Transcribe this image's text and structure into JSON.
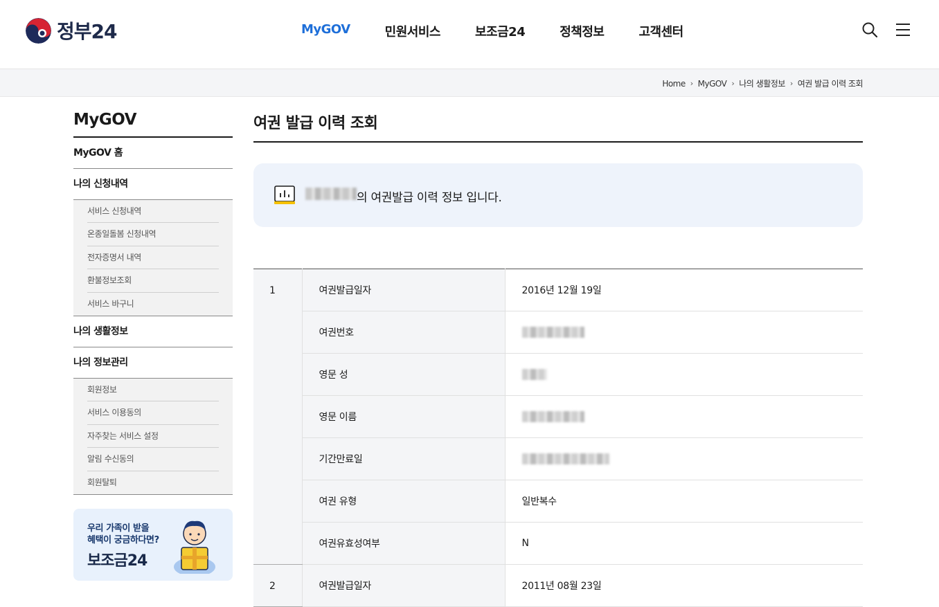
{
  "header": {
    "logo_text": "정부24",
    "nav": [
      "MyGOV",
      "민원서비스",
      "보조금24",
      "정책정보",
      "고객센터"
    ],
    "active_nav": "MyGOV",
    "search_icon": "search-icon",
    "menu_icon": "hamburger-menu-icon"
  },
  "breadcrumb": [
    "Home",
    "MyGOV",
    "나의 생활정보",
    "여권 발급 이력 조회"
  ],
  "sidebar": {
    "title": "MyGOV",
    "home": "MyGOV 홈",
    "applications": {
      "label": "나의 신청내역",
      "items": [
        "서비스 신청내역",
        "온종일돌봄 신청내역",
        "전자증명서 내역",
        "환불정보조회",
        "서비스 바구니"
      ]
    },
    "life_info": "나의 생활정보",
    "info_mgmt": {
      "label": "나의 정보관리",
      "items": [
        "회원정보",
        "서비스 이용동의",
        "자주찾는 서비스 설정",
        "알림 수신동의",
        "회원탈퇴"
      ]
    },
    "banner": {
      "line1": "우리 가족이 받을",
      "line2": "혜택이 궁금하다면?",
      "brand": "보조금24"
    }
  },
  "main": {
    "title": "여권 발급 이력 조회",
    "info_text": "의 여권발급 이력 정보 입니다.",
    "records": [
      {
        "index": "1",
        "rows": [
          {
            "label": "여권발급일자",
            "value": "2016년 12월 19일"
          },
          {
            "label": "여권번호",
            "value": ""
          },
          {
            "label": "영문 성",
            "value": ""
          },
          {
            "label": "영문 이름",
            "value": ""
          },
          {
            "label": "기간만료일",
            "value": ""
          },
          {
            "label": "여권 유형",
            "value": "일반복수"
          },
          {
            "label": "여권유효성여부",
            "value": "N"
          }
        ]
      },
      {
        "index": "2",
        "rows": [
          {
            "label": "여권발급일자",
            "value": "2011년 08월 23일"
          }
        ]
      }
    ]
  },
  "colors": {
    "accent": "#1e6fd9",
    "info_bg": "#eef3fb",
    "table_label_bg": "#f4f5f7"
  }
}
